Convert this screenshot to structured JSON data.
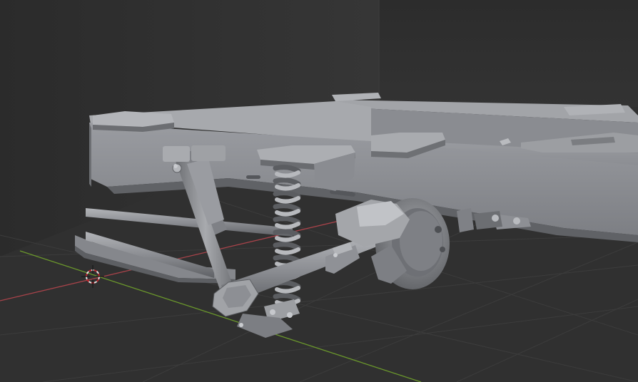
{
  "viewport": {
    "background_color": "#2f2f2f",
    "grid_color": "#3d3d3d",
    "x_axis_color": "#b8474e",
    "y_axis_color": "#6f9a2e",
    "model_color": "#8f9196",
    "model_shadow_color": "#5e6064",
    "model_highlight_color": "#b5b7bb",
    "cursor_color_a": "#e4e4e4",
    "cursor_color_b": "#c0242b"
  },
  "scene": {
    "object_type": "truck-chassis-rear-suspension",
    "visible_parts": [
      "frame-rails",
      "cross-member",
      "shock-absorber",
      "coil-spring",
      "axle-tube",
      "differential-housing",
      "trailing-links",
      "spring-mounts"
    ]
  },
  "overlays": {
    "3d_cursor_icon": "crosshair-ring"
  }
}
